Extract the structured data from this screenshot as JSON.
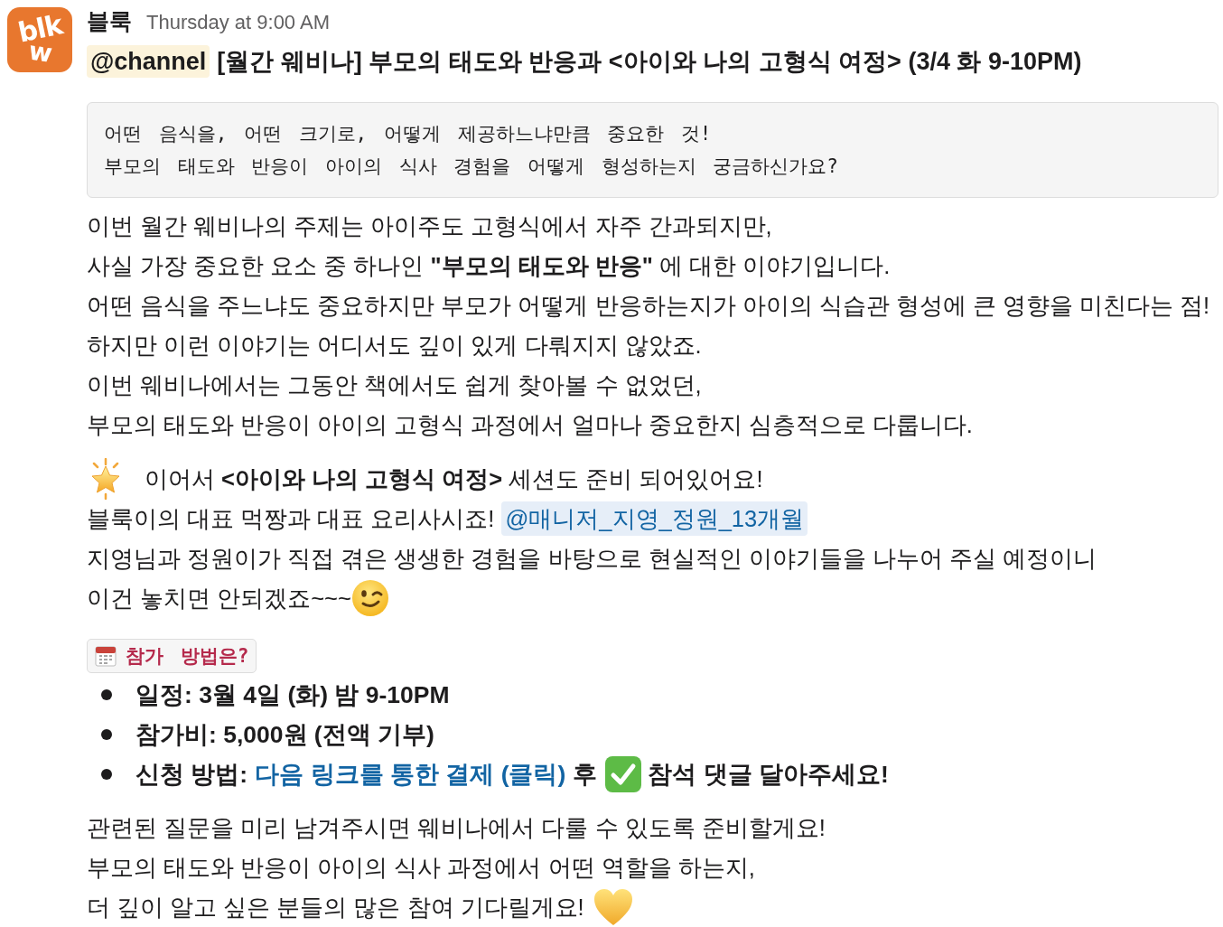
{
  "message": {
    "avatar": {
      "logo_lines": [
        "blk",
        "w"
      ]
    },
    "sender": "블룩",
    "timestamp": "Thursday at 9:00 AM",
    "title": {
      "mention": "@channel",
      "text": "[월간 웨비나] 부모의 태도와 반응과 <아이와 나의 고형식 여정> (3/4 화 9-10PM)"
    },
    "quote": [
      "어떤 음식을, 어떤 크기로, 어떻게 제공하느냐만큼 중요한 것!",
      "부모의 태도와 반응이 아이의 식사 경험을 어떻게 형성하는지 궁금하신가요?"
    ],
    "intro": [
      "이번 월간 웨비나의 주제는 아이주도 고형식에서 자주 간과되지만,",
      "사실 가장 중요한 요소 중 하나인 **\"부모의 태도와 반응\"** 에 대한 이야기입니다.",
      "어떤 음식을 주느냐도 중요하지만 부모가 어떻게 반응하는지가 아이의 식습관 형성에 큰 영향을 미친다는 점!",
      "하지만 이런 이야기는 어디서도 깊이 있게 다뤄지지 않았죠.",
      "이번 웨비나에서는 그동안 책에서도 쉽게 찾아볼 수 없었던,",
      "부모의 태도와 반응이 아이의 고형식 과정에서 얼마나 중요한지 심층적으로 다룹니다."
    ],
    "session": [
      {
        "text": "이어서 **<아이와 나의 고형식 여정>** 세션도 준비 되어있어요!"
      },
      {
        "text": "블룩이의 대표 먹짱과 대표 요리사시죠!",
        "mention": "@매니저_지영_정원_13개월"
      },
      {
        "text": "지영님과 정원이가 직접 겪은 생생한 경험을 바탕으로 현실적인 이야기들을 나누어 주실 예정이니"
      },
      {
        "text": "이건 놓치면 안되겠죠~~~"
      }
    ],
    "how_to_join": {
      "heading": "참가 방법은?",
      "items": [
        {
          "text": "일정: 3월 4일 (화) 밤 9-10PM"
        },
        {
          "text": "참가비: 5,000원 (전액 기부)"
        },
        {
          "text": "신청 방법:",
          "link": "다음 링크를 통한 결제 (클릭)",
          "after_link": "후",
          "after_check": "참석 댓글 달아주세요!"
        }
      ]
    },
    "closing": [
      "관련된 질문을 미리 남겨주시면 웨비나에서 다룰 수 있도록 준비할게요!",
      "부모의 태도와 반응이 아이의 식사 과정에서 어떤 역할을 하는지,",
      "더 깊이 알고 싶은 분들의 많은 참여 기다릴게요!"
    ]
  }
}
